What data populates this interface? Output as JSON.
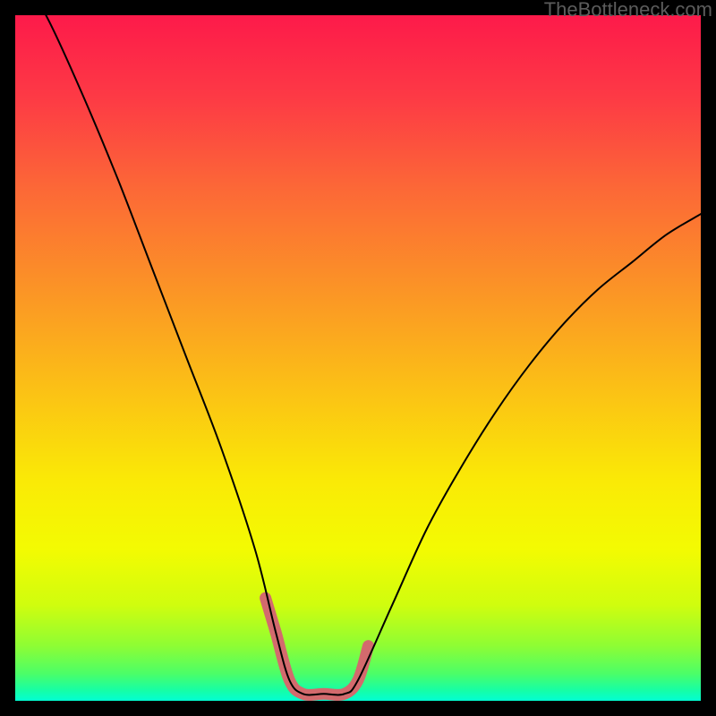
{
  "watermark": "TheBottleneck.com",
  "colors": {
    "black": "#000000",
    "curve": "#000000",
    "highlight": "#d36a6d"
  },
  "chart_data": {
    "type": "line",
    "title": "",
    "xlabel": "",
    "ylabel": "",
    "xlim": [
      0,
      100
    ],
    "ylim": [
      0,
      100
    ],
    "grid": false,
    "note": "Values are read in percent units of the plot area; x measured from the left edge, y is the curve's height above the bottom edge. Estimated from gridless axes.",
    "series": [
      {
        "name": "bottleneck-curve",
        "x": [
          0,
          5,
          10,
          15,
          20,
          25,
          30,
          35,
          38,
          40,
          42,
          45,
          48,
          50,
          55,
          60,
          65,
          70,
          75,
          80,
          85,
          90,
          95,
          100
        ],
        "y": [
          108,
          99,
          88,
          76,
          63,
          50,
          37,
          22,
          10,
          3,
          1,
          1,
          1,
          3,
          14,
          25,
          34,
          42,
          49,
          55,
          60,
          64,
          68,
          71
        ]
      },
      {
        "name": "optimal-highlight",
        "x": [
          36.5,
          38,
          40,
          42,
          45,
          48,
          50,
          51.5
        ],
        "y": [
          15,
          10,
          3,
          1,
          1,
          1,
          3,
          8
        ]
      }
    ],
    "background_gradient": {
      "type": "custom-vertical",
      "stops": [
        {
          "pos": 0.0,
          "color": "#fd1a4a"
        },
        {
          "pos": 0.12,
          "color": "#fd3a45"
        },
        {
          "pos": 0.25,
          "color": "#fc6737"
        },
        {
          "pos": 0.4,
          "color": "#fb9426"
        },
        {
          "pos": 0.55,
          "color": "#fbc215"
        },
        {
          "pos": 0.68,
          "color": "#faea06"
        },
        {
          "pos": 0.78,
          "color": "#f3fb02"
        },
        {
          "pos": 0.86,
          "color": "#d0fd0e"
        },
        {
          "pos": 0.92,
          "color": "#8efd34"
        },
        {
          "pos": 0.96,
          "color": "#4cfe67"
        },
        {
          "pos": 0.985,
          "color": "#16fea6"
        },
        {
          "pos": 1.0,
          "color": "#02fed3"
        }
      ]
    }
  }
}
